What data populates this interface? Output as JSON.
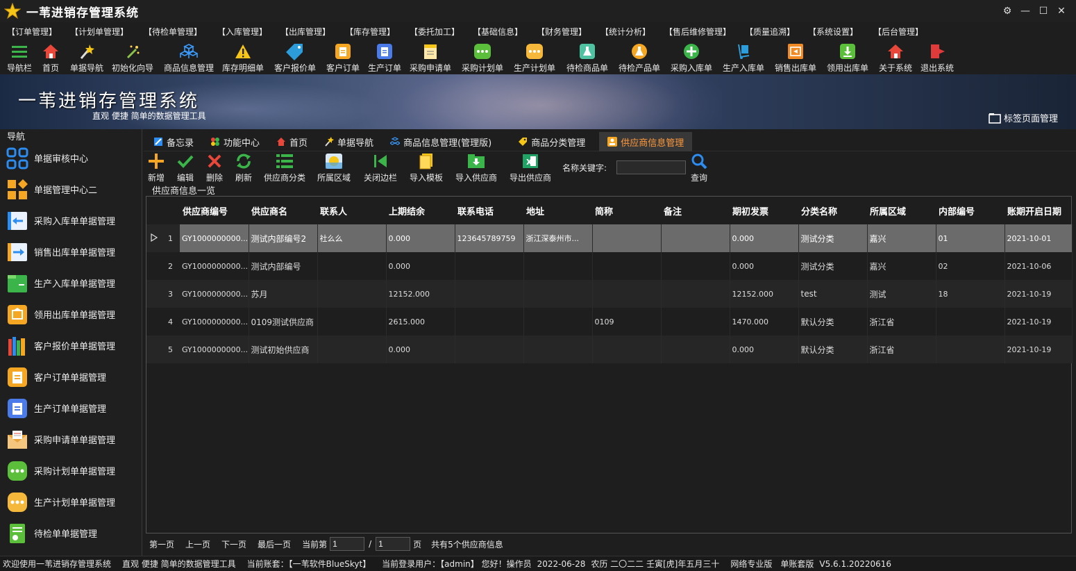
{
  "window": {
    "title": "一苇进销存管理系统"
  },
  "menu": [
    "【订单管理】",
    "【计划单管理】",
    "【待检单管理】",
    "【入库管理】",
    "【出库管理】",
    "【库存管理】",
    "【委托加工】",
    "【基础信息】",
    "【财务管理】",
    "【统计分析】",
    "【售后维修管理】",
    "【质量追溯】",
    "【系统设置】",
    "【后台管理】"
  ],
  "toolbar": [
    {
      "label": "导航栏",
      "icon": "menu-icon"
    },
    {
      "label": "首页",
      "icon": "home-icon"
    },
    {
      "label": "单据导航",
      "icon": "wand-icon"
    },
    {
      "label": "初始化向导",
      "icon": "magic-wand-icon"
    },
    {
      "label": "商品信息管理",
      "icon": "cubes-icon"
    },
    {
      "label": "库存明细单",
      "icon": "warning-icon"
    },
    {
      "label": "客户报价单",
      "icon": "price-tag-icon"
    },
    {
      "label": "客户订单",
      "icon": "order-icon"
    },
    {
      "label": "生产订单",
      "icon": "document-icon"
    },
    {
      "label": "采购申请单",
      "icon": "clipboard-icon"
    },
    {
      "label": "采购计划单",
      "icon": "chat-bubble-icon"
    },
    {
      "label": "生产计划单",
      "icon": "chat-bubble-icon"
    },
    {
      "label": "待检商品单",
      "icon": "flask-icon"
    },
    {
      "label": "待检产品单",
      "icon": "beaker-icon"
    },
    {
      "label": "采购入库单",
      "icon": "plus-circle-icon"
    },
    {
      "label": "生产入库单",
      "icon": "hand-truck-icon"
    },
    {
      "label": "销售出库单",
      "icon": "outbox-icon"
    },
    {
      "label": "领用出库单",
      "icon": "download-box-icon"
    },
    {
      "label": "关于系统",
      "icon": "house-icon"
    },
    {
      "label": "退出系统",
      "icon": "exit-icon"
    }
  ],
  "banner": {
    "title": "一苇进销存管理系统",
    "subtitle": "直观 便捷 简单的数据管理工具",
    "tab_manager": "标签页面管理"
  },
  "sidebar": {
    "title": "导航",
    "items": [
      {
        "label": "单据审核中心",
        "icon": "grid-apps-icon"
      },
      {
        "label": "单据管理中心二",
        "icon": "grid-diamond-icon"
      },
      {
        "label": "采购入库单单据管理",
        "icon": "arrow-left-box-icon"
      },
      {
        "label": "销售出库单单据管理",
        "icon": "arrow-right-box-icon"
      },
      {
        "label": "生产入库单单据管理",
        "icon": "folder-icon"
      },
      {
        "label": "领用出库单单据管理",
        "icon": "package-icon"
      },
      {
        "label": "客户报价单单据管理",
        "icon": "books-icon"
      },
      {
        "label": "客户订单单据管理",
        "icon": "order-icon"
      },
      {
        "label": "生产订单单据管理",
        "icon": "document-icon"
      },
      {
        "label": "采购申请单单据管理",
        "icon": "envelope-icon"
      },
      {
        "label": "采购计划单单据管理",
        "icon": "chat-bubble-icon"
      },
      {
        "label": "生产计划单单据管理",
        "icon": "chat-bubble-icon"
      },
      {
        "label": "待检单单据管理",
        "icon": "checklist-icon"
      }
    ]
  },
  "tabs": [
    {
      "label": "备忘录",
      "icon": "memo-icon"
    },
    {
      "label": "功能中心",
      "icon": "apps-icon"
    },
    {
      "label": "首页",
      "icon": "home-icon"
    },
    {
      "label": "单据导航",
      "icon": "wand-icon"
    },
    {
      "label": "商品信息管理(管理版)",
      "icon": "cubes-icon"
    },
    {
      "label": "商品分类管理",
      "icon": "tag-icon"
    },
    {
      "label": "供应商信息管理",
      "icon": "supplier-icon",
      "active": true
    }
  ],
  "content_toolbar": {
    "buttons": [
      {
        "label": "新增",
        "icon": "plus-icon"
      },
      {
        "label": "编辑",
        "icon": "check-icon"
      },
      {
        "label": "删除",
        "icon": "delete-icon"
      },
      {
        "label": "刷新",
        "icon": "refresh-icon"
      },
      {
        "label": "供应商分类",
        "icon": "list-icon"
      },
      {
        "label": "所属区域",
        "icon": "region-icon"
      },
      {
        "label": "关闭边栏",
        "icon": "collapse-icon"
      },
      {
        "label": "导入模板",
        "icon": "template-icon"
      },
      {
        "label": "导入供应商",
        "icon": "import-icon"
      },
      {
        "label": "导出供应商",
        "icon": "excel-icon"
      }
    ],
    "keyword_label": "名称关键字:",
    "keyword_value": "",
    "search_label": "查询"
  },
  "list_title": "供应商信息一览",
  "table": {
    "columns": [
      "供应商编号",
      "供应商名",
      "联系人",
      "上期结余",
      "联系电话",
      "地址",
      "简称",
      "备注",
      "期初发票",
      "分类名称",
      "所属区域",
      "内部编号",
      "账期开启日期"
    ],
    "rows": [
      {
        "n": "1",
        "cells": [
          "GY1000000000...",
          "测试内部编号2",
          "社么么",
          "0.000",
          "123645789759",
          "浙江深泰州市...",
          "",
          "",
          "0.000",
          "测试分类",
          "嘉兴",
          "01",
          "2021-10-01"
        ],
        "selected": true
      },
      {
        "n": "2",
        "cells": [
          "GY1000000000...",
          "测试内部编号",
          "",
          "0.000",
          "",
          "",
          "",
          "",
          "0.000",
          "测试分类",
          "嘉兴",
          "02",
          "2021-10-06"
        ]
      },
      {
        "n": "3",
        "cells": [
          "GY1000000000...",
          "苏月",
          "",
          "12152.000",
          "",
          "",
          "",
          "",
          "12152.000",
          "test",
          "测试",
          "18",
          "2021-10-19"
        ]
      },
      {
        "n": "4",
        "cells": [
          "GY1000000000...",
          "0109测试供应商",
          "",
          "2615.000",
          "",
          "",
          "0109",
          "",
          "1470.000",
          "默认分类",
          "浙江省",
          "",
          "2021-10-19"
        ]
      },
      {
        "n": "5",
        "cells": [
          "GY1000000000...",
          "测试初始供应商",
          "",
          "0.000",
          "",
          "",
          "",
          "",
          "0.000",
          "默认分类",
          "浙江省",
          "",
          "2021-10-19"
        ]
      }
    ]
  },
  "pager": {
    "first": "第一页",
    "prev": "上一页",
    "next": "下一页",
    "last": "最后一页",
    "current_label": "当前第",
    "current": "1",
    "sep": "/",
    "total": "1",
    "page_unit": "页",
    "summary": "共有5个供应商信息"
  },
  "status": {
    "welcome": "欢迎使用一苇进销存管理系统",
    "slogan": "直观 便捷 简单的数据管理工具",
    "account": "当前账套：【一苇软件BlueSkyt】",
    "user": "当前登录用户：【admin】 您好！操作员",
    "date": "2022-06-28",
    "lunar": "农历 二〇二二 壬寅[虎]年五月三十",
    "edition": "网络专业版",
    "mode": "单账套版",
    "version": "V5.6.1.20220616"
  }
}
